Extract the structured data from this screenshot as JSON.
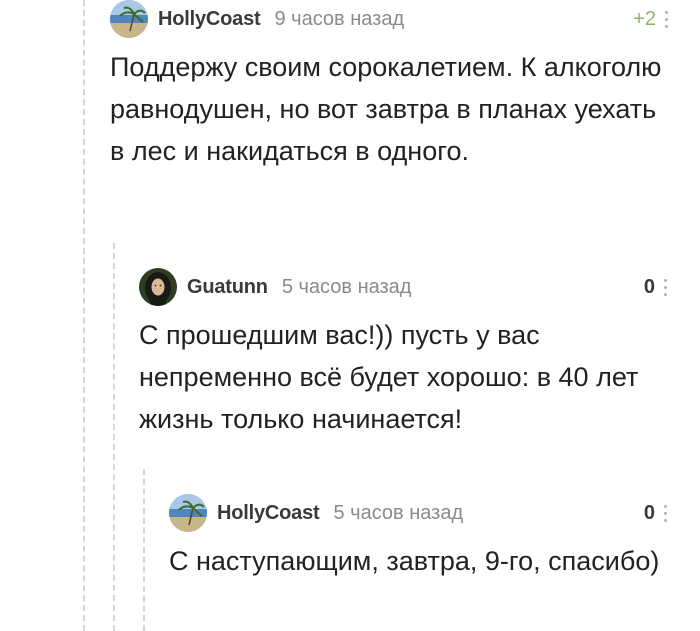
{
  "comments": [
    {
      "username": "HollyCoast",
      "time": "9 часов назад",
      "rating": "+2",
      "text": "Поддержу своим сорокалетием. К алкоголю равнодушен, но вот завтра в планах уехать в лес и накидаться в одного."
    },
    {
      "username": "Guatunn",
      "time": "5 часов назад",
      "rating": "0",
      "text": "С прошедшим вас!)) пусть у вас непременно всё будет хорошо: в 40 лет жизнь только начинается!"
    },
    {
      "username": "HollyCoast",
      "time": "5 часов назад",
      "rating": "0",
      "text": "С наступающим, завтра, 9-го, спасибо)"
    }
  ],
  "colors": {
    "positive_rating": "#8cb36b",
    "thread_line": "#d6d6d6",
    "muted_text": "#8a8a8a"
  }
}
